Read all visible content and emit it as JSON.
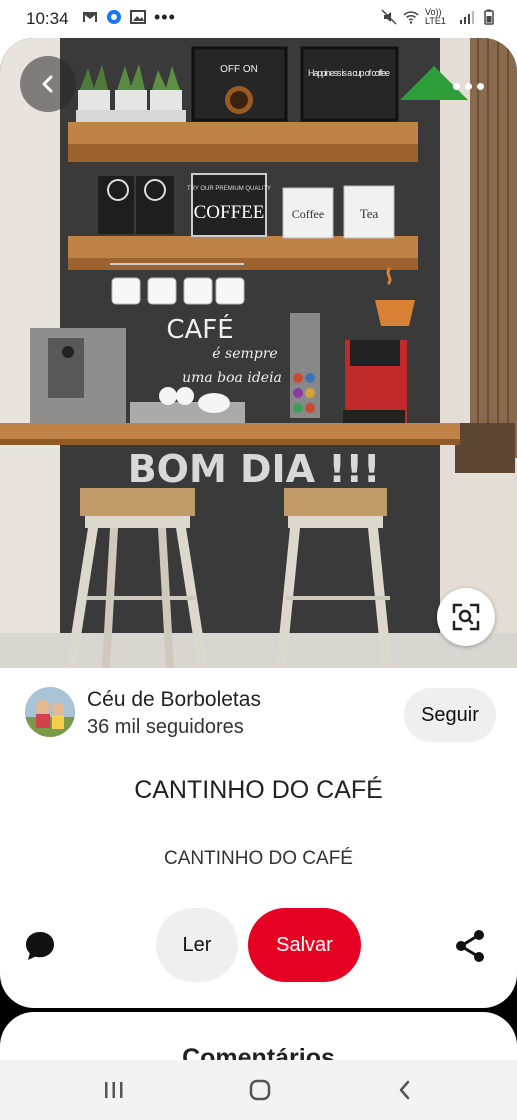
{
  "status_bar": {
    "time": "10:34",
    "left_icons": [
      "gmail-icon",
      "messenger-icon",
      "gallery-icon",
      "more-notifications-icon"
    ],
    "network_label": "Vo)) LTE1",
    "right_icons": [
      "mute-icon",
      "wifi-icon",
      "signal-icon",
      "battery-icon"
    ]
  },
  "pin": {
    "image_text": {
      "off_on": "OFF  ON",
      "happiness": "Happiness is a cup of coffee",
      "coffee_sign_top": "TRY OUR PREMIUM QUALITY",
      "coffee_sign": "COFFEE",
      "coffee_canister": "Coffee",
      "tea_canister": "Tea",
      "chalk_cafe": "CAFÉ",
      "chalk_sempre": "é sempre",
      "chalk_ideia": "uma boa ideia",
      "chalk_bom_dia": "BOM DIA !!!"
    },
    "creator": {
      "name": "Céu de Borboletas",
      "followers": "36 mil seguidores",
      "follow_label": "Seguir"
    },
    "title": "CANTINHO DO CAFÉ",
    "description": "CANTINHO DO CAFÉ",
    "actions": {
      "read_label": "Ler",
      "save_label": "Salvar"
    }
  },
  "comments": {
    "heading": "Comentários"
  },
  "colors": {
    "save_red": "#e60023",
    "button_gray": "#efefef",
    "chalkboard": "#3b3b3b",
    "wood": "#b9773f"
  }
}
